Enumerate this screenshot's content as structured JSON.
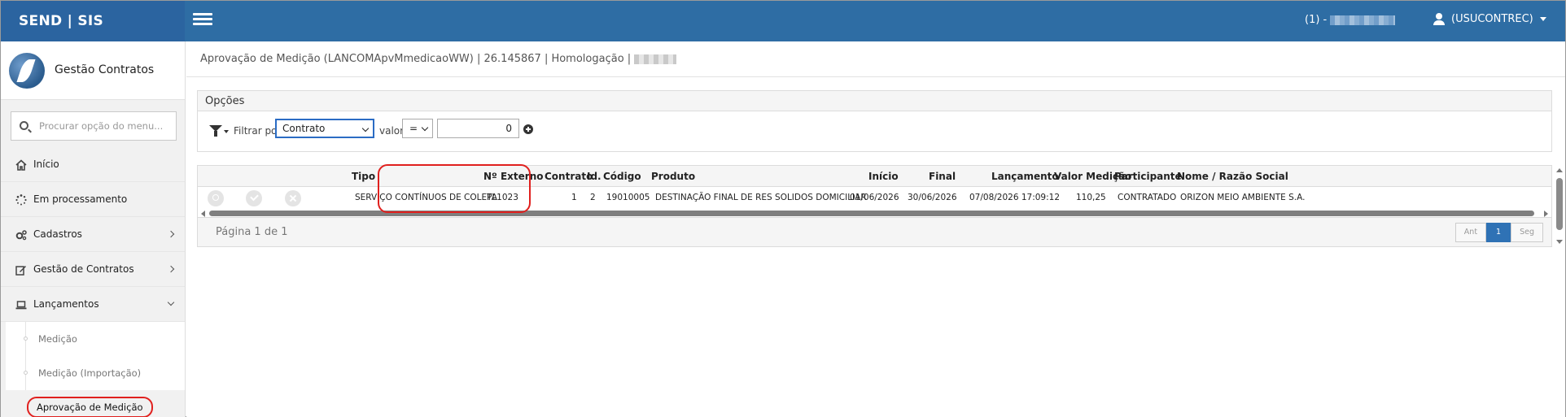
{
  "brand": {
    "name": "SEND | SIS"
  },
  "topbar": {
    "env_label": "(1) -",
    "user_label": "(USUCONTREC)"
  },
  "sidebar": {
    "app_title": "Gestão Contratos",
    "search_placeholder": "Procurar opção do menu...",
    "items": [
      {
        "label": "Início",
        "icon": "home-icon"
      },
      {
        "label": "Em processamento",
        "icon": "spinner-icon"
      },
      {
        "label": "Cadastros",
        "icon": "gears-icon"
      },
      {
        "label": "Gestão de Contratos",
        "icon": "edit-icon"
      },
      {
        "label": "Lançamentos",
        "icon": "laptop-icon"
      }
    ],
    "subitems": [
      {
        "label": "Medição"
      },
      {
        "label": "Medição (Importação)"
      },
      {
        "label": "Aprovação de Medição"
      }
    ]
  },
  "page": {
    "header_text": "Aprovação de Medição (LANCOMApvMmedicaoWW) | 26.145867 | Homologação |"
  },
  "options": {
    "title": "Opções",
    "filter_label": "Filtrar por",
    "filter_value": "Contrato",
    "value_label": "valor",
    "operator": "=",
    "number_value": "0"
  },
  "grid": {
    "headers": {
      "tipo": "Tipo",
      "n_externo": "Nº Externo",
      "contrato": "Contrato",
      "id": "Id.",
      "codigo": "Código",
      "produto": "Produto",
      "inicio": "Início",
      "final": "Final",
      "lancamento": "Lançamento",
      "valor_medicao": "Valor Medição",
      "participante": "Participante",
      "nome": "Nome / Razão Social"
    },
    "rows": [
      {
        "tipo": "SERVIÇO CONTÍNUOS DE COLETA",
        "n_externo": "PL1023",
        "contrato": "1",
        "id": "2",
        "codigo": "19010005",
        "produto": "DESTINAÇÃO FINAL DE RES SOLIDOS DOMICILIAR",
        "inicio": "01/06/2026",
        "final": "30/06/2026",
        "lancamento": "07/08/2026 17:09:12",
        "valor_medicao": "110,25",
        "participante": "CONTRATADO",
        "nome": "ORIZON MEIO AMBIENTE S.A."
      }
    ],
    "page_info": "Página 1 de 1",
    "pager": {
      "prev": "Ant",
      "current": "1",
      "next": "Seg"
    }
  },
  "colors": {
    "topbar": "#2e6da4",
    "highlight": "#e0201e",
    "pager_active": "#2f72b5"
  }
}
